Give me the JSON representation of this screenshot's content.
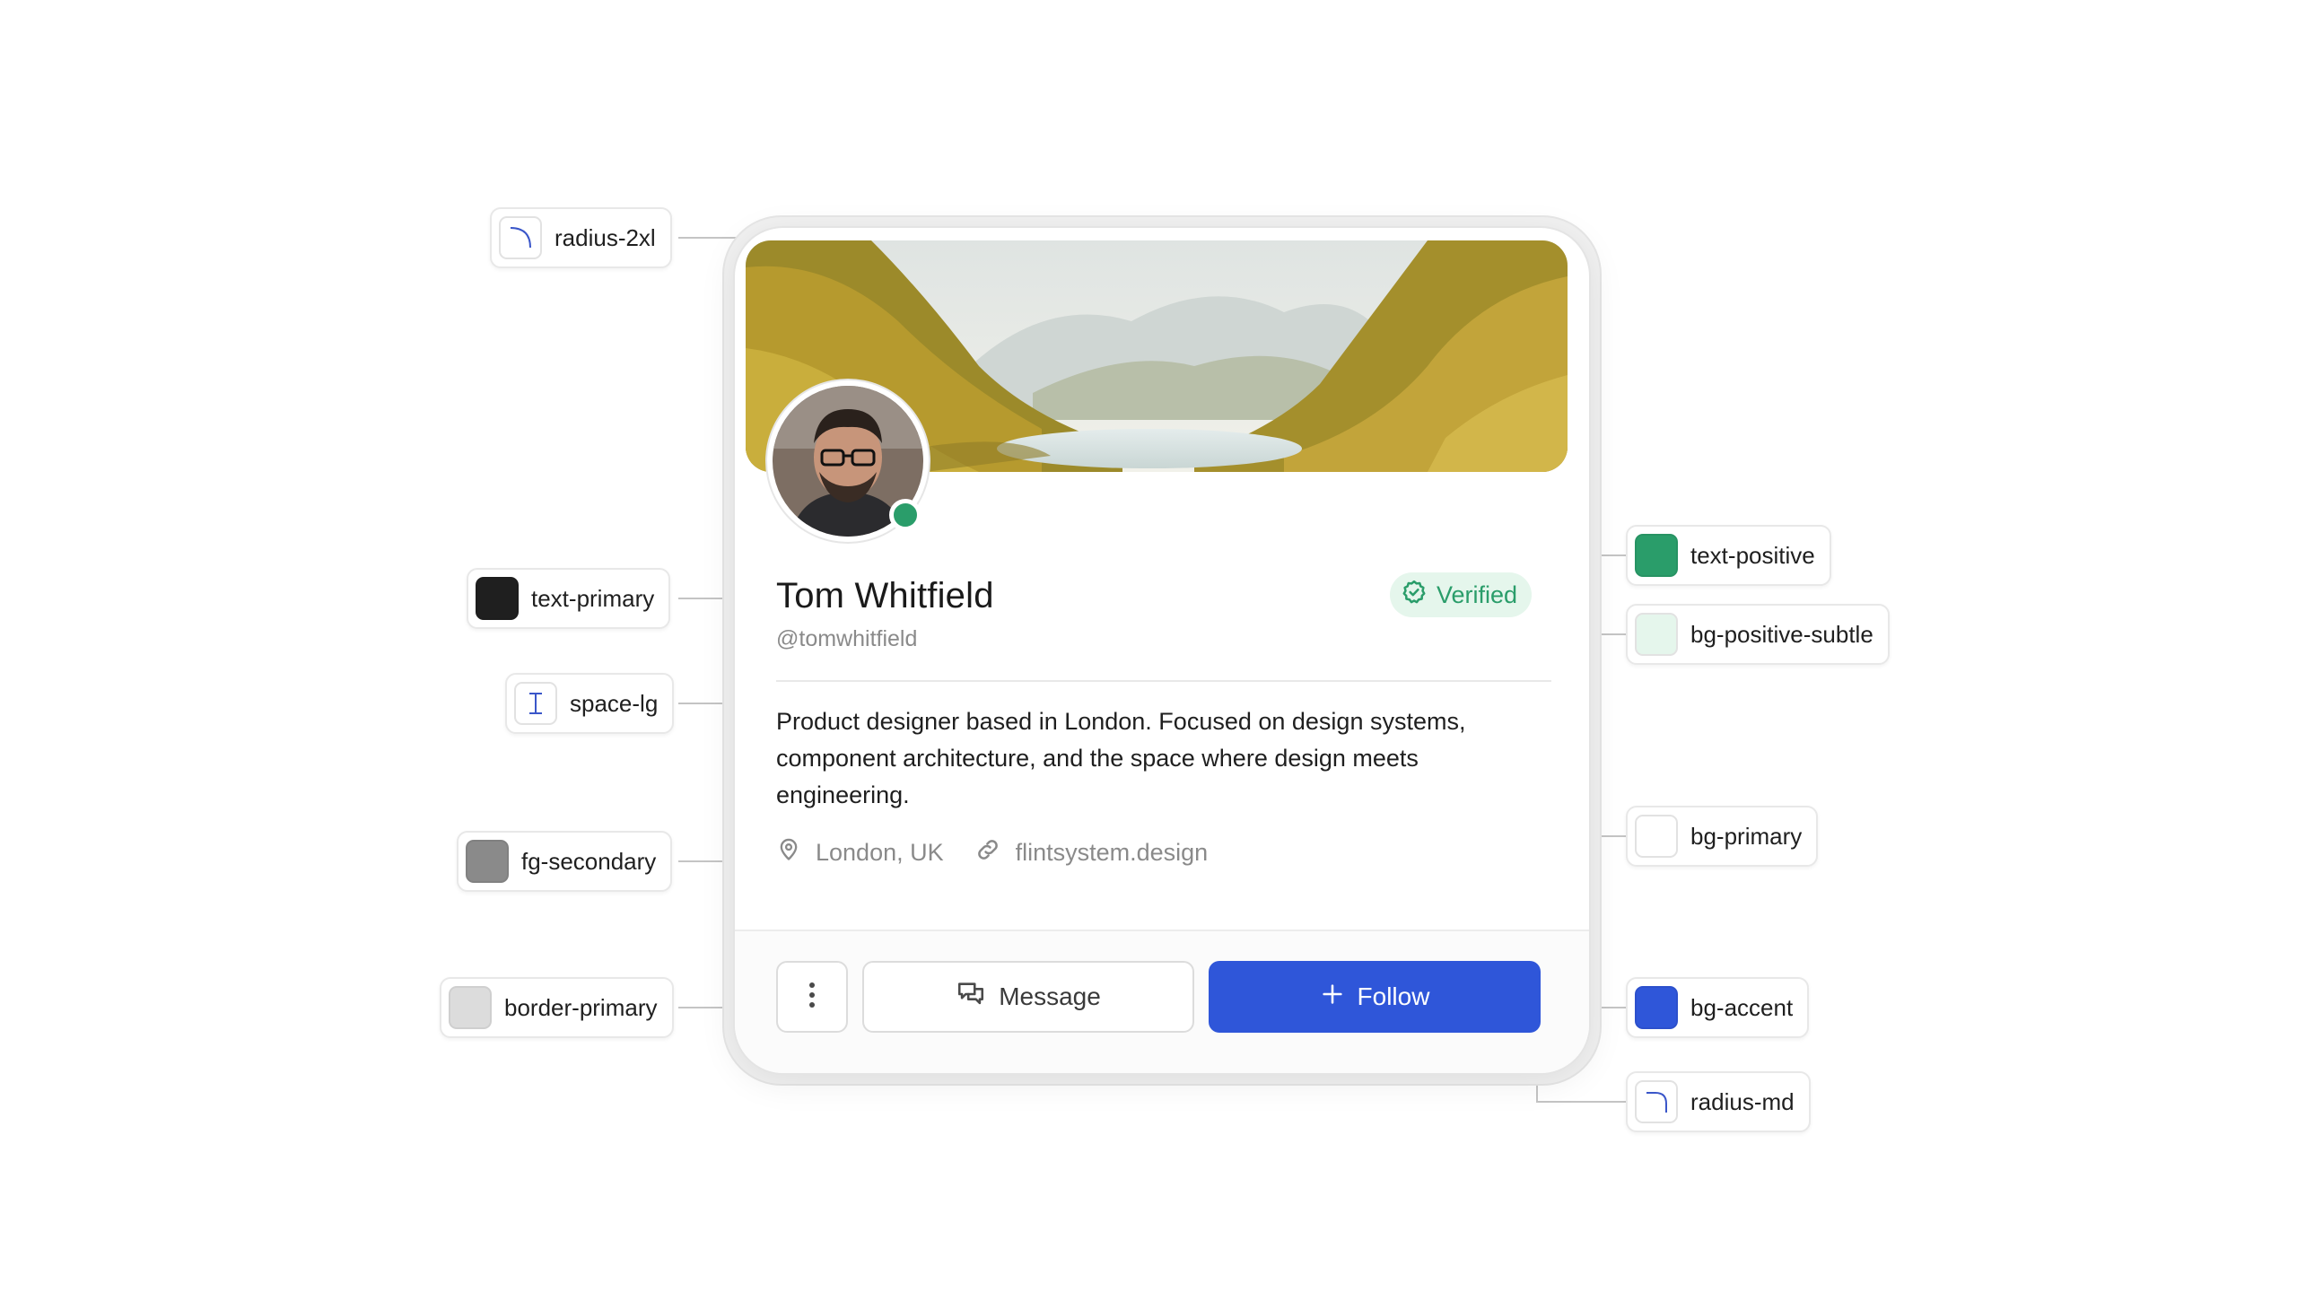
{
  "profile": {
    "name": "Tom Whitfield",
    "handle": "@tomwhitfield",
    "verified_label": "Verified",
    "bio": "Product designer based in London. Focused on design systems, component architecture, and the space where design meets engineering.",
    "location": "London, UK",
    "website": "flintsystem.design",
    "online": true
  },
  "actions": {
    "message_label": "Message",
    "follow_label": "Follow"
  },
  "tokens": {
    "radius_2xl": "radius-2xl",
    "text_primary": "text-primary",
    "space_lg": "space-lg",
    "fg_secondary": "fg-secondary",
    "border_primary": "border-primary",
    "text_positive": "text-positive",
    "bg_positive_subtle": "bg-positive-subtle",
    "bg_primary": "bg-primary",
    "bg_accent": "bg-accent",
    "radius_md": "radius-md"
  },
  "colors": {
    "text_primary": "#1f1f1f",
    "fg_secondary": "#8a8a8a",
    "border_primary": "#dcdcdc",
    "text_positive": "#2a9d6a",
    "bg_positive_subtle": "#e5f6ec",
    "bg_primary": "#ffffff",
    "bg_accent": "#2f56d9"
  }
}
